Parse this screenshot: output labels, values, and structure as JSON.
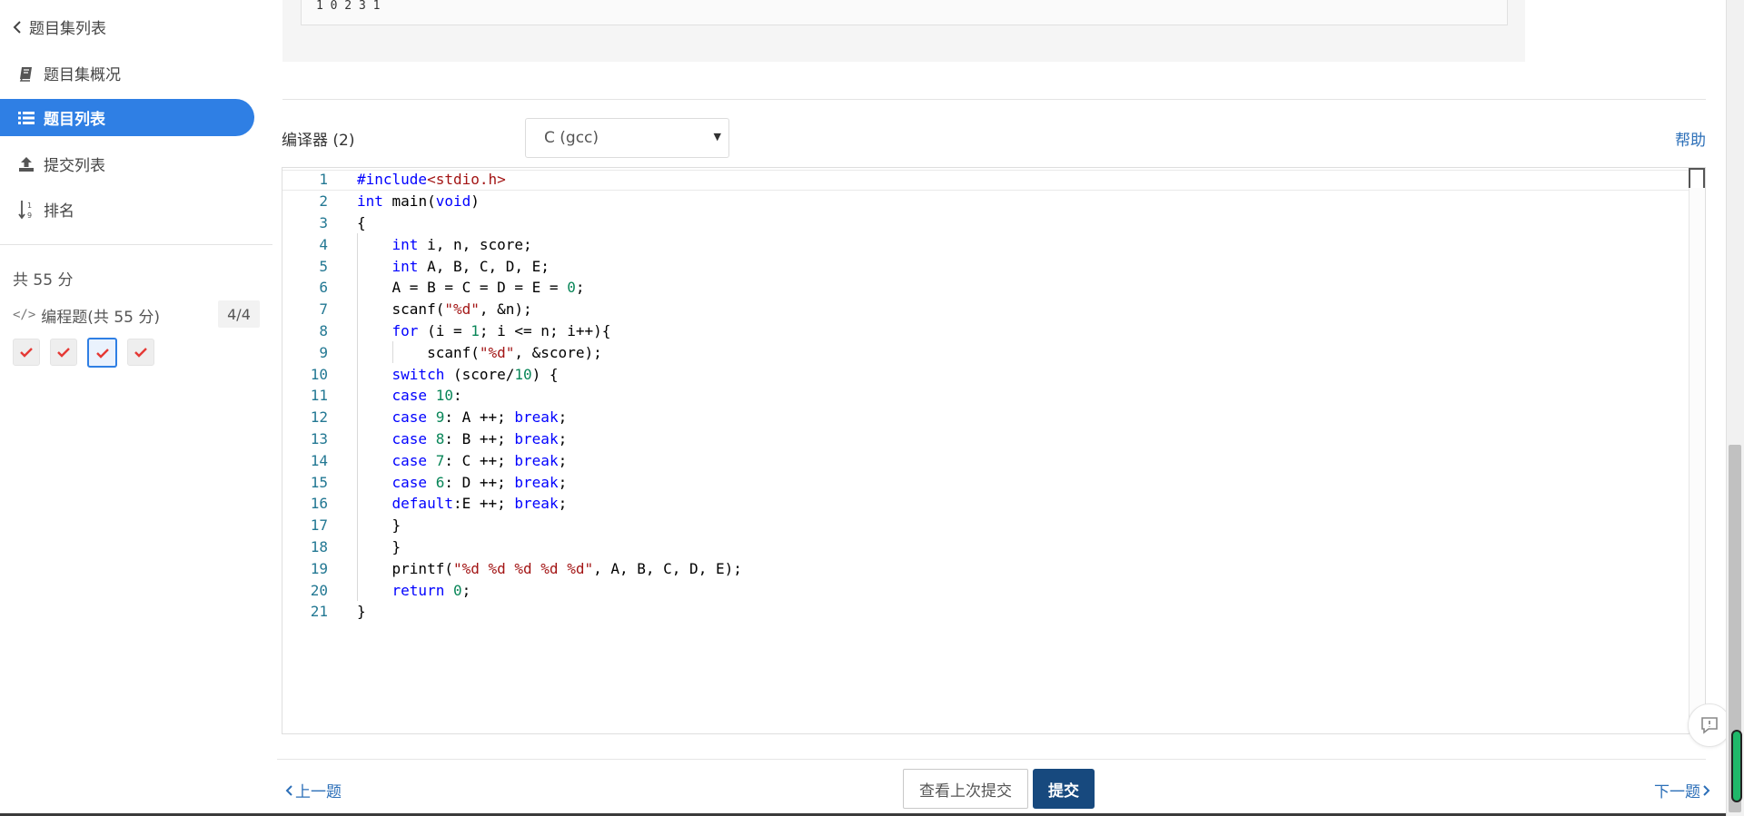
{
  "sidebar": {
    "back_label": "题目集列表",
    "items": [
      {
        "label": "题目集概况"
      },
      {
        "label": "题目列表"
      },
      {
        "label": "提交列表"
      },
      {
        "label": "排名"
      }
    ],
    "total_score": "共 55 分",
    "section": {
      "label": "编程题(共 55 分)",
      "count": "4/4"
    },
    "problem_status": [
      "passed",
      "passed",
      "passed",
      "passed"
    ],
    "active_color": "#2f7fe4"
  },
  "sample": {
    "output": "1 0 2 3 1"
  },
  "editor": {
    "compiler_label": "编译器 (2)",
    "language": "C (gcc)",
    "help_label": "帮助",
    "line_numbers": [
      "1",
      "2",
      "3",
      "4",
      "5",
      "6",
      "7",
      "8",
      "9",
      "10",
      "11",
      "12",
      "13",
      "14",
      "15",
      "16",
      "17",
      "18",
      "19",
      "20",
      "21"
    ]
  },
  "footer": {
    "prev_label": "上一题",
    "view_last_label": "查看上次提交",
    "submit_label": "提交",
    "next_label": "下一题",
    "submit_color": "#17497e"
  },
  "icons": {
    "back": "chevron-left-icon",
    "overview": "book-icon",
    "problems": "list-icon",
    "submissions": "upload-icon",
    "rank": "sort-number-icon",
    "section": "code-icon",
    "check": "checkmark-icon",
    "feedback": "feedback-icon"
  }
}
